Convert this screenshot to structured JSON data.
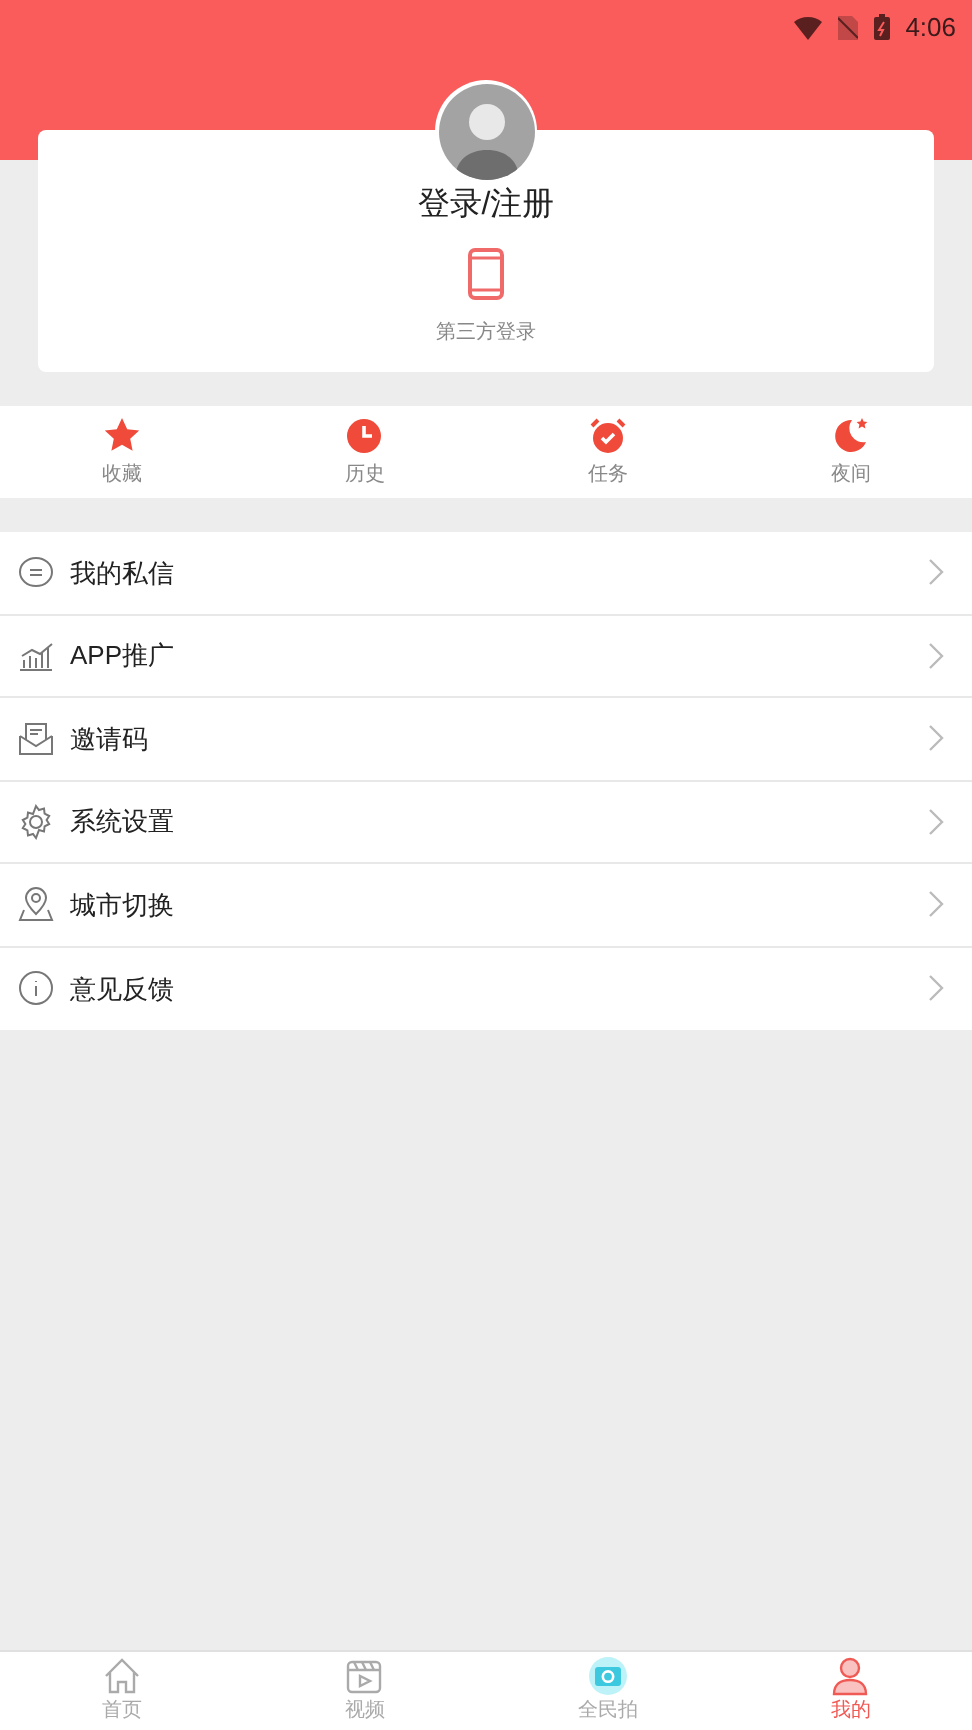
{
  "status_bar": {
    "time": "4:06"
  },
  "profile": {
    "login_label": "登录/注册",
    "third_party_label": "第三方登录"
  },
  "shortcuts": [
    {
      "kind": "star",
      "label": "收藏"
    },
    {
      "kind": "clock",
      "label": "历史"
    },
    {
      "kind": "alarm",
      "label": "任务"
    },
    {
      "kind": "moon",
      "label": "夜间"
    }
  ],
  "menu": [
    {
      "kind": "message",
      "label": "我的私信"
    },
    {
      "kind": "chart",
      "label": "APP推广"
    },
    {
      "kind": "envelope",
      "label": "邀请码"
    },
    {
      "kind": "gear",
      "label": "系统设置"
    },
    {
      "kind": "location",
      "label": "城市切换"
    },
    {
      "kind": "info",
      "label": "意见反馈"
    }
  ],
  "bottom_nav": [
    {
      "kind": "home",
      "label": "首页",
      "selected": false
    },
    {
      "kind": "video",
      "label": "视频",
      "selected": false
    },
    {
      "kind": "camera",
      "label": "全民拍",
      "selected": false
    },
    {
      "kind": "person",
      "label": "我的",
      "selected": true
    }
  ]
}
